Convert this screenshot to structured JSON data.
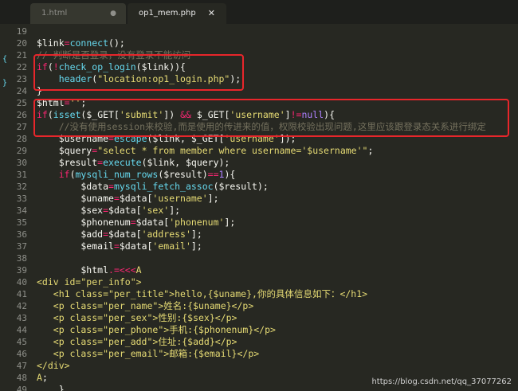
{
  "tabs": [
    {
      "label": "1.html",
      "indicator": "●"
    },
    {
      "label": "op1_mem.php",
      "indicator": "✕"
    }
  ],
  "lines": [
    {
      "n": "19",
      "segs": []
    },
    {
      "n": "20",
      "segs": [
        {
          "c": "var",
          "t": "$link"
        },
        {
          "c": "kw",
          "t": "="
        },
        {
          "c": "fn",
          "t": "connect"
        },
        {
          "c": "var",
          "t": "();"
        }
      ]
    },
    {
      "n": "21",
      "segs": [
        {
          "c": "cm",
          "t": "// 判断是否登录，没有登录不能访问"
        }
      ]
    },
    {
      "n": "22",
      "segs": [
        {
          "c": "kw",
          "t": "if"
        },
        {
          "c": "var",
          "t": "("
        },
        {
          "c": "kw",
          "t": "!"
        },
        {
          "c": "fn",
          "t": "check_op_login"
        },
        {
          "c": "var",
          "t": "($link)){"
        }
      ]
    },
    {
      "n": "23",
      "segs": [
        {
          "c": "var",
          "t": "    "
        },
        {
          "c": "fn",
          "t": "header"
        },
        {
          "c": "var",
          "t": "("
        },
        {
          "c": "str",
          "t": "\"location:op1_login.php\""
        },
        {
          "c": "var",
          "t": ");"
        }
      ]
    },
    {
      "n": "24",
      "segs": [
        {
          "c": "var",
          "t": "}"
        }
      ]
    },
    {
      "n": "25",
      "segs": [
        {
          "c": "var",
          "t": "$html"
        },
        {
          "c": "kw",
          "t": "="
        },
        {
          "c": "str",
          "t": "''"
        },
        {
          "c": "var",
          "t": ";"
        }
      ]
    },
    {
      "n": "26",
      "segs": [
        {
          "c": "kw",
          "t": "if"
        },
        {
          "c": "var",
          "t": "("
        },
        {
          "c": "fn",
          "t": "isset"
        },
        {
          "c": "var",
          "t": "($_GET["
        },
        {
          "c": "str",
          "t": "'submit'"
        },
        {
          "c": "var",
          "t": "]) "
        },
        {
          "c": "kw",
          "t": "&&"
        },
        {
          "c": "var",
          "t": " $_GET["
        },
        {
          "c": "str",
          "t": "'username'"
        },
        {
          "c": "var",
          "t": "]"
        },
        {
          "c": "kw",
          "t": "!="
        },
        {
          "c": "num",
          "t": "null"
        },
        {
          "c": "var",
          "t": "){"
        }
      ]
    },
    {
      "n": "27",
      "segs": [
        {
          "c": "cm",
          "t": "    //没有使用session来校验,而是使用的传进来的值，权限校验出现问题,这里应该跟登录态关系进行绑定"
        }
      ]
    },
    {
      "n": "28",
      "segs": [
        {
          "c": "var",
          "t": "    $username"
        },
        {
          "c": "kw",
          "t": "="
        },
        {
          "c": "fn",
          "t": "escape"
        },
        {
          "c": "var",
          "t": "($link, $_GET["
        },
        {
          "c": "str",
          "t": "'username'"
        },
        {
          "c": "var",
          "t": "]);"
        }
      ]
    },
    {
      "n": "29",
      "segs": [
        {
          "c": "var",
          "t": "    $query"
        },
        {
          "c": "kw",
          "t": "="
        },
        {
          "c": "str",
          "t": "\"select * from member where username='$username'\""
        },
        {
          "c": "var",
          "t": ";"
        }
      ]
    },
    {
      "n": "30",
      "segs": [
        {
          "c": "var",
          "t": "    $result"
        },
        {
          "c": "kw",
          "t": "="
        },
        {
          "c": "fn",
          "t": "execute"
        },
        {
          "c": "var",
          "t": "($link, $query);"
        }
      ]
    },
    {
      "n": "31",
      "segs": [
        {
          "c": "var",
          "t": "    "
        },
        {
          "c": "kw",
          "t": "if"
        },
        {
          "c": "var",
          "t": "("
        },
        {
          "c": "fn",
          "t": "mysqli_num_rows"
        },
        {
          "c": "var",
          "t": "($result)"
        },
        {
          "c": "kw",
          "t": "=="
        },
        {
          "c": "num",
          "t": "1"
        },
        {
          "c": "var",
          "t": "){"
        }
      ]
    },
    {
      "n": "32",
      "segs": [
        {
          "c": "var",
          "t": "        $data"
        },
        {
          "c": "kw",
          "t": "="
        },
        {
          "c": "fn",
          "t": "mysqli_fetch_assoc"
        },
        {
          "c": "var",
          "t": "($result);"
        }
      ]
    },
    {
      "n": "33",
      "segs": [
        {
          "c": "var",
          "t": "        $uname"
        },
        {
          "c": "kw",
          "t": "="
        },
        {
          "c": "var",
          "t": "$data["
        },
        {
          "c": "str",
          "t": "'username'"
        },
        {
          "c": "var",
          "t": "];"
        }
      ]
    },
    {
      "n": "34",
      "segs": [
        {
          "c": "var",
          "t": "        $sex"
        },
        {
          "c": "kw",
          "t": "="
        },
        {
          "c": "var",
          "t": "$data["
        },
        {
          "c": "str",
          "t": "'sex'"
        },
        {
          "c": "var",
          "t": "];"
        }
      ]
    },
    {
      "n": "35",
      "segs": [
        {
          "c": "var",
          "t": "        $phonenum"
        },
        {
          "c": "kw",
          "t": "="
        },
        {
          "c": "var",
          "t": "$data["
        },
        {
          "c": "str",
          "t": "'phonenum'"
        },
        {
          "c": "var",
          "t": "];"
        }
      ]
    },
    {
      "n": "36",
      "segs": [
        {
          "c": "var",
          "t": "        $add"
        },
        {
          "c": "kw",
          "t": "="
        },
        {
          "c": "var",
          "t": "$data["
        },
        {
          "c": "str",
          "t": "'address'"
        },
        {
          "c": "var",
          "t": "];"
        }
      ]
    },
    {
      "n": "37",
      "segs": [
        {
          "c": "var",
          "t": "        $email"
        },
        {
          "c": "kw",
          "t": "="
        },
        {
          "c": "var",
          "t": "$data["
        },
        {
          "c": "str",
          "t": "'email'"
        },
        {
          "c": "var",
          "t": "];"
        }
      ]
    },
    {
      "n": "38",
      "segs": []
    },
    {
      "n": "39",
      "segs": [
        {
          "c": "var",
          "t": "        $html"
        },
        {
          "c": "kw",
          "t": ".=<<<"
        },
        {
          "c": "str",
          "t": "A"
        }
      ]
    },
    {
      "n": "40",
      "segs": [
        {
          "c": "str",
          "t": "<div id=\"per_info\">"
        }
      ]
    },
    {
      "n": "41",
      "segs": [
        {
          "c": "str",
          "t": "   <h1 class=\"per_title\">hello,{$uname},你的具体信息如下：</h1>"
        }
      ]
    },
    {
      "n": "42",
      "segs": [
        {
          "c": "str",
          "t": "   <p class=\"per_name\">姓名:{$uname}</p>"
        }
      ]
    },
    {
      "n": "43",
      "segs": [
        {
          "c": "str",
          "t": "   <p class=\"per_sex\">性别:{$sex}</p>"
        }
      ]
    },
    {
      "n": "44",
      "segs": [
        {
          "c": "str",
          "t": "   <p class=\"per_phone\">手机:{$phonenum}</p>"
        }
      ]
    },
    {
      "n": "45",
      "segs": [
        {
          "c": "str",
          "t": "   <p class=\"per_add\">住址:{$add}</p>"
        }
      ]
    },
    {
      "n": "46",
      "segs": [
        {
          "c": "str",
          "t": "   <p class=\"per_email\">邮箱:{$email}</p>"
        }
      ]
    },
    {
      "n": "47",
      "segs": [
        {
          "c": "str",
          "t": "</div>"
        }
      ]
    },
    {
      "n": "48",
      "segs": [
        {
          "c": "str",
          "t": "A"
        },
        {
          "c": "var",
          "t": ";"
        }
      ]
    },
    {
      "n": "49",
      "segs": [
        {
          "c": "var",
          "t": "    }"
        }
      ]
    },
    {
      "n": "50",
      "segs": [
        {
          "c": "var",
          "t": "}"
        }
      ]
    }
  ],
  "fold_markers": {
    "line22": "{",
    "line24": "}"
  },
  "watermark": "https://blog.csdn.net/qq_37077262",
  "colors": {
    "background": "#272822",
    "keyword": "#f92672",
    "function": "#66d9ef",
    "string": "#e6db74",
    "comment": "#75715e",
    "highlight_box": "#e8262b"
  }
}
